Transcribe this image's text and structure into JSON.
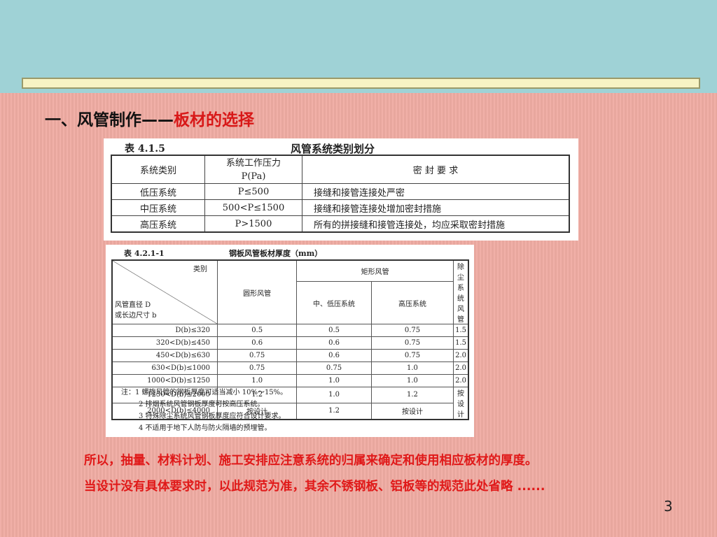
{
  "title": {
    "black": "一、风管制作——",
    "red": "板材的选择"
  },
  "table1": {
    "number": "表 4.1.5",
    "caption": "风管系统类别划分",
    "headers": [
      "系统类别",
      "系统工作压力",
      "P(Pa)",
      "密 封 要 求"
    ],
    "rows": [
      [
        "低压系统",
        "P≤500",
        "接缝和接管连接处严密"
      ],
      [
        "中压系统",
        "500<P≤1500",
        "接缝和接管连接处增加密封措施"
      ],
      [
        "高压系统",
        "P>1500",
        "所有的拼接缝和接管连接处，均应采取密封措施"
      ]
    ]
  },
  "table2": {
    "number": "表 4.2.1-1",
    "caption": "钢板风管板材厚度（mm）",
    "diag_top": "类别",
    "diag_bottom_1": "风管直径 D",
    "diag_bottom_2": "或长边尺寸 b",
    "col_round": "圆形风管",
    "col_rect": "矩形风管",
    "col_mid_low": "中、低压系统",
    "col_high": "高压系统",
    "col_dust": "除尘系统风管",
    "rows": [
      [
        "D(b)≤320",
        "0.5",
        "0.5",
        "0.75",
        "1.5"
      ],
      [
        "320<D(b)≤450",
        "0.6",
        "0.6",
        "0.75",
        "1.5"
      ],
      [
        "450<D(b)≤630",
        "0.75",
        "0.6",
        "0.75",
        "2.0"
      ],
      [
        "630<D(b)≤1000",
        "0.75",
        "0.75",
        "1.0",
        "2.0"
      ],
      [
        "1000<D(b)≤1250",
        "1.0",
        "1.0",
        "1.0",
        "2.0"
      ],
      [
        "1250<D(b)≤2000",
        "1.2",
        "1.0",
        "1.2",
        "按设计"
      ],
      [
        "2000<D(b)≤4000",
        "按设计",
        "1.2",
        "按设计",
        ""
      ]
    ],
    "notes": [
      "注：1   螺旋风管的钢板厚度可适当减小 10%～15%。",
      "2   排烟系统风管钢板厚度可按高压系统。",
      "3   特殊除尘系统风管钢板厚度应符合设计要求。",
      "4   不适用于地下人防与防火隔墙的预埋管。"
    ]
  },
  "body": {
    "line1": "所以，抽量、材料计划、施工安排应注意系统的归属来确定和使用相应板材的厚度。",
    "line2": "当设计没有具体要求时，以此规范为准，其余不锈钢板、铝板等的规范此处省略 ......"
  },
  "page_number": "3"
}
